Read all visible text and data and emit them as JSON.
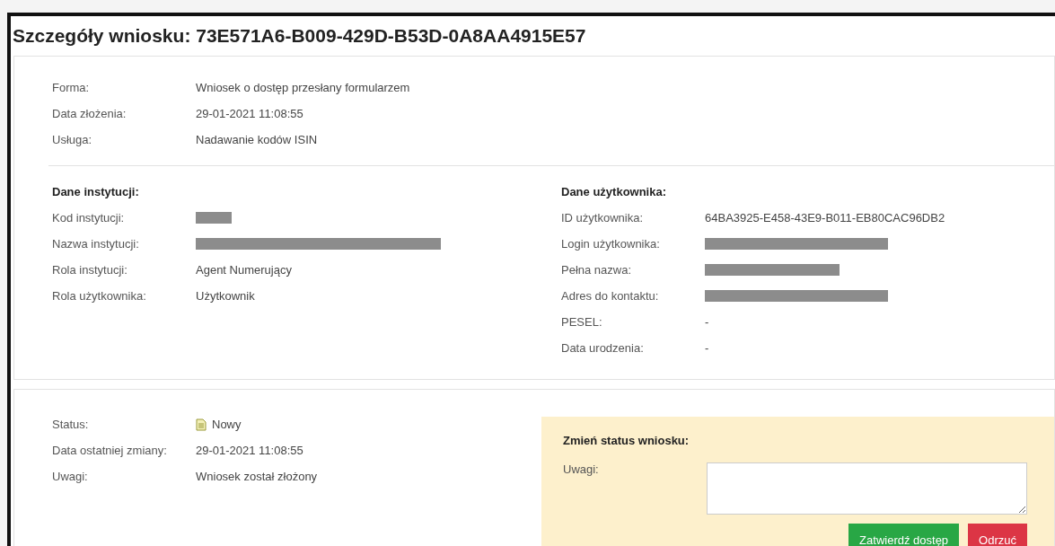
{
  "title": "Szczegóły wniosku: 73E571A6-B009-429D-B53D-0A8AA4915E57",
  "summary": [
    {
      "label": "Forma:",
      "value": "Wniosek o dostęp przesłany formularzem"
    },
    {
      "label": "Data złożenia:",
      "value": "29-01-2021 11:08:55"
    },
    {
      "label": "Usługa:",
      "value": "Nadawanie kodów ISIN"
    }
  ],
  "institution": {
    "heading": "Dane instytucji:",
    "fields": [
      {
        "label": "Kod instytucji:",
        "kind": "short"
      },
      {
        "label": "Nazwa instytucji:",
        "kind": "long"
      },
      {
        "label": "Rola instytucji:",
        "value": "Agent Numerujący"
      },
      {
        "label": "Rola użytkownika:",
        "value": "Użytkownik"
      }
    ]
  },
  "user": {
    "heading": "Dane użytkownika:",
    "fields": [
      {
        "label": "ID użytkownika:",
        "value": "64BA3925-E458-43E9-B011-EB80CAC96DB2"
      },
      {
        "label": "Login użytkownika:",
        "kind": "medium"
      },
      {
        "label": "Pełna nazwa:",
        "kind": "small"
      },
      {
        "label": "Adres do kontaktu:",
        "kind": "medium"
      },
      {
        "label": "PESEL:",
        "value": "-"
      },
      {
        "label": "Data urodzenia:",
        "value": "-"
      }
    ]
  },
  "status": [
    {
      "label": "Status:",
      "value": "Nowy",
      "kind": "status"
    },
    {
      "label": "Data ostatniej zmiany:",
      "value": "29-01-2021 11:08:55",
      "kind": "text"
    },
    {
      "label": "Uwagi:",
      "value": "Wniosek został złożony",
      "kind": "text"
    }
  ],
  "change_status": {
    "heading": "Zmień status wniosku:",
    "remarks_label": "Uwagi:",
    "buttons": [
      {
        "label": "Zatwierdź dostęp",
        "kind": "approve"
      },
      {
        "label": "Odrzuć",
        "kind": "reject"
      }
    ]
  }
}
